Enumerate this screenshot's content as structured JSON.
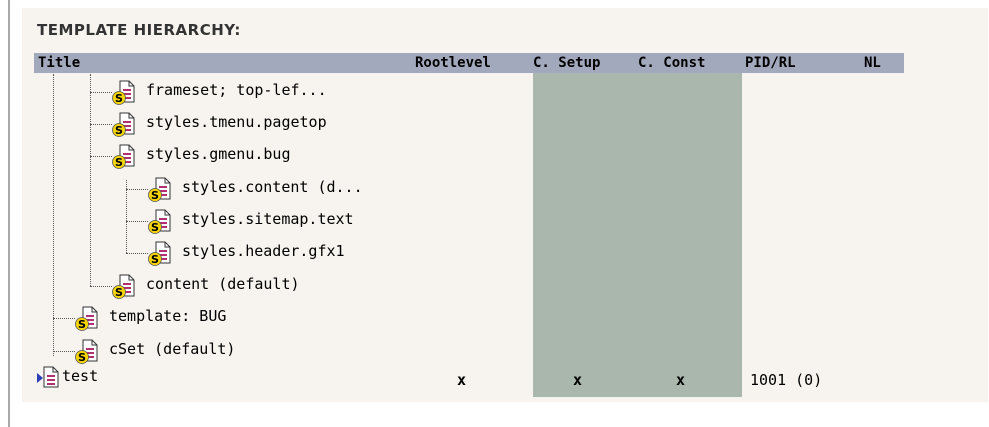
{
  "heading": "TEMPLATE HIERARCHY:",
  "columns": {
    "title": "Title",
    "rootlevel": "Rootlevel",
    "c_setup": "C. Setup",
    "c_const": "C. Const",
    "pid_rl": "PID/RL",
    "nl": "NL"
  },
  "tree": [
    {
      "label": "frameset; top-lef...",
      "icon": "template-s-icon"
    },
    {
      "label": "styles.tmenu.pagetop",
      "icon": "template-s-icon"
    },
    {
      "label": "styles.gmenu.bug",
      "icon": "template-s-icon"
    },
    {
      "label": "styles.content (d...",
      "icon": "template-s-icon"
    },
    {
      "label": "styles.sitemap.text",
      "icon": "template-s-icon"
    },
    {
      "label": "styles.header.gfx1",
      "icon": "template-s-icon"
    },
    {
      "label": "content (default)",
      "icon": "template-s-icon"
    },
    {
      "label": "template: BUG",
      "icon": "template-s-icon"
    },
    {
      "label": "cSet (default)",
      "icon": "template-s-icon"
    },
    {
      "label": "test",
      "icon": "template-page-icon"
    }
  ],
  "test_row": {
    "rootlevel": "x",
    "c_setup": "x",
    "c_const": "x",
    "pid_rl": "1001 (0)",
    "nl": ""
  },
  "colors": {
    "header_bar": "#a3a9bd",
    "setup_column": "#a9b7ad",
    "panel": "#f7f3ef"
  }
}
